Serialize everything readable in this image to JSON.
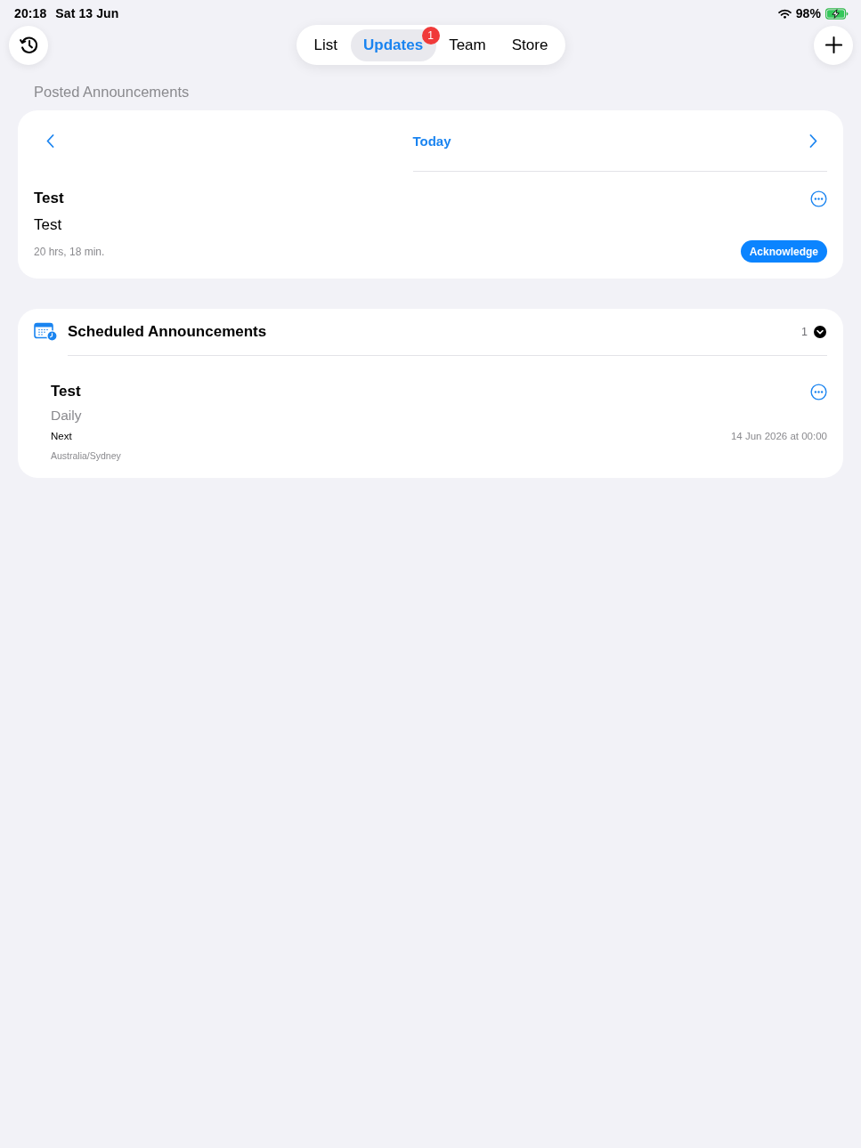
{
  "status_bar": {
    "time": "20:18",
    "date": "Sat 13 Jun",
    "battery": "98%"
  },
  "nav": {
    "tabs": [
      {
        "label": "List",
        "selected": false
      },
      {
        "label": "Updates",
        "selected": true,
        "badge": "1"
      },
      {
        "label": "Team",
        "selected": false
      },
      {
        "label": "Store",
        "selected": false
      }
    ]
  },
  "posted": {
    "heading": "Posted Announcements",
    "date_label": "Today",
    "items": [
      {
        "title": "Test",
        "body": "Test",
        "age": "20 hrs, 18 min.",
        "action": "Acknowledge"
      }
    ]
  },
  "scheduled": {
    "title": "Scheduled Announcements",
    "count": "1",
    "expanded": true,
    "items": [
      {
        "title": "Test",
        "repeat": "Daily",
        "next_label": "Next",
        "next_value": "14 Jun 2026 at 00:00",
        "timezone": "Australia/Sydney"
      }
    ]
  }
}
